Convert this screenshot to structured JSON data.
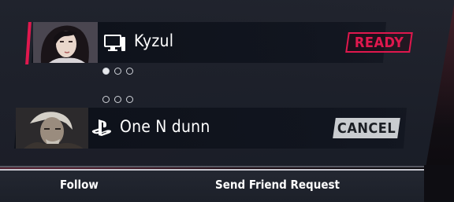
{
  "players": [
    {
      "name": "Kyzul",
      "platform_icon": "pc-icon",
      "status_button": "READY",
      "status_color": "#e0184e",
      "portrait": "female-fighter-portrait"
    },
    {
      "name": "One N dunn",
      "platform_icon": "playstation-icon",
      "status_button": "CANCEL",
      "status_color": "#c9ccd0",
      "portrait": "male-fighter-portrait"
    }
  ],
  "round_indicators": {
    "player1": [
      true,
      false,
      false
    ],
    "player2": [
      false,
      false,
      false
    ]
  },
  "actions": {
    "follow": "Follow",
    "friend_request": "Send Friend Request"
  },
  "accent_color": "#e0184e"
}
